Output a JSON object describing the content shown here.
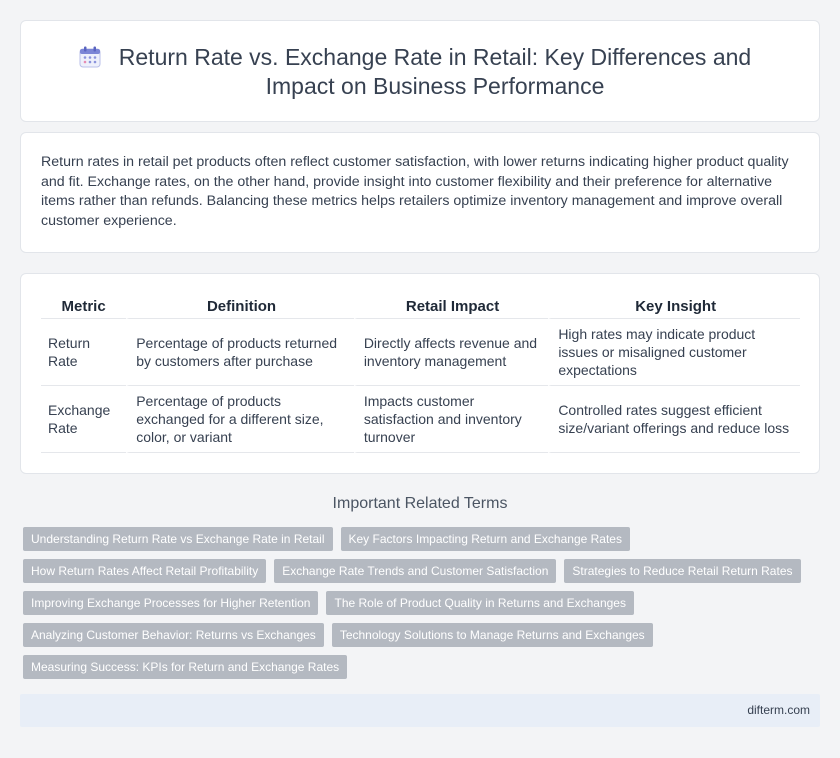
{
  "header": {
    "icon": "calendar-icon",
    "title": "Return Rate vs. Exchange Rate in Retail: Key Differences and Impact on Business Performance"
  },
  "intro": {
    "text": "Return rates in retail pet products often reflect customer satisfaction, with lower returns indicating higher product quality and fit. Exchange rates, on the other hand, provide insight into customer flexibility and their preference for alternative items rather than refunds. Balancing these metrics helps retailers optimize inventory management and improve overall customer experience."
  },
  "table": {
    "headers": [
      "Metric",
      "Definition",
      "Retail Impact",
      "Key Insight"
    ],
    "rows": [
      [
        "Return Rate",
        "Percentage of products returned by customers after purchase",
        "Directly affects revenue and inventory management",
        "High rates may indicate product issues or misaligned customer expectations"
      ],
      [
        "Exchange Rate",
        "Percentage of products exchanged for a different size, color, or variant",
        "Impacts customer satisfaction and inventory turnover",
        "Controlled rates suggest efficient size/variant offerings and reduce loss"
      ]
    ]
  },
  "related": {
    "heading": "Important Related Terms",
    "rows": [
      [
        "Understanding Return Rate vs Exchange Rate in Retail",
        "Key Factors Impacting Return and Exchange Rates"
      ],
      [
        "How Return Rates Affect Retail Profitability",
        "Exchange Rate Trends and Customer Satisfaction",
        "Strategies to Reduce Retail Return Rates"
      ],
      [
        "Improving Exchange Processes for Higher Retention",
        "The Role of Product Quality in Returns and Exchanges"
      ],
      [
        "Analyzing Customer Behavior: Returns vs Exchanges",
        "Technology Solutions to Manage Returns and Exchanges"
      ],
      [
        "Measuring Success: KPIs for Return and Exchange Rates"
      ]
    ]
  },
  "footer": {
    "site": "difterm.com"
  },
  "colors": {
    "tag_bg": "#b4b9c1",
    "footer_bg": "#e8eef7",
    "page_bg": "#f3f4f6"
  }
}
